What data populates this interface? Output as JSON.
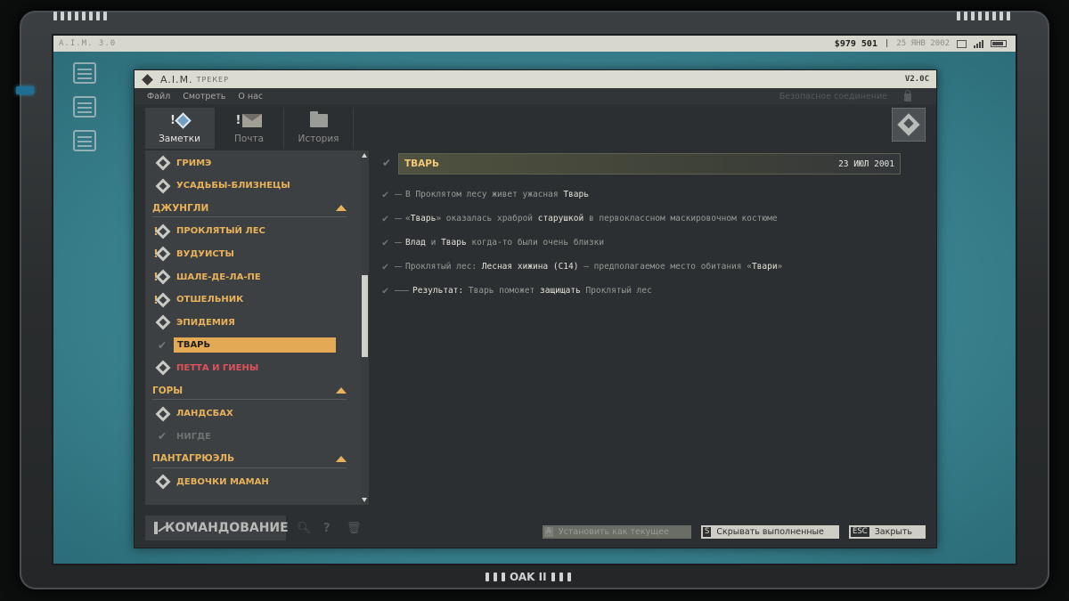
{
  "os": {
    "title": "A.I.M. 3.0",
    "money": "$979 501",
    "date": "25 ЯНВ 2002"
  },
  "brand": "OAK II",
  "window": {
    "name": "A.I.M.",
    "subtitle": "ТРЕКЕР",
    "version": "V2.0C",
    "menu": [
      "Файл",
      "Смотреть",
      "О нас"
    ],
    "secure": "Безопасное соединение"
  },
  "tabs": [
    {
      "label": "Заметки",
      "icon": "notes-diamond-icon",
      "alert": "!"
    },
    {
      "label": "Почта",
      "icon": "mail-icon",
      "alert": "!"
    },
    {
      "label": "История",
      "icon": "folder-icon",
      "alert": ""
    }
  ],
  "sidebar": {
    "items": [
      {
        "type": "item",
        "label": "ГРИМЭ",
        "alert": false,
        "state": "normal"
      },
      {
        "type": "item",
        "label": "УСАДЬБЫ-БЛИЗНЕЦЫ",
        "alert": false,
        "state": "normal"
      },
      {
        "type": "category",
        "label": "ДЖУНГЛИ"
      },
      {
        "type": "item",
        "label": "ПРОКЛЯТЫЙ ЛЕС",
        "alert": true,
        "state": "normal"
      },
      {
        "type": "item",
        "label": "ВУДУИСТЫ",
        "alert": true,
        "state": "normal"
      },
      {
        "type": "item",
        "label": "ШАЛЕ-ДЕ-ЛА-ПЕ",
        "alert": true,
        "state": "normal"
      },
      {
        "type": "item",
        "label": "ОТШЕЛЬНИК",
        "alert": true,
        "state": "normal"
      },
      {
        "type": "item",
        "label": "ЭПИДЕМИЯ",
        "alert": false,
        "state": "normal"
      },
      {
        "type": "item",
        "label": "ТВАРЬ",
        "alert": false,
        "state": "selected"
      },
      {
        "type": "item",
        "label": "ПЕТТА И ГИЕНЫ",
        "alert": false,
        "state": "red"
      },
      {
        "type": "category",
        "label": "ГОРЫ"
      },
      {
        "type": "item",
        "label": "ЛАНДСБАХ",
        "alert": false,
        "state": "normal"
      },
      {
        "type": "item",
        "label": "НИГДЕ",
        "alert": false,
        "state": "done"
      },
      {
        "type": "category",
        "label": "ПАНТАГРЮЭЛЬ"
      },
      {
        "type": "item",
        "label": "ДЕВОЧКИ МАМАН",
        "alert": false,
        "state": "normal"
      }
    ]
  },
  "detail": {
    "title": "ТВАРЬ",
    "date": "23 ИЮЛ 2001",
    "notes": [
      {
        "parts": [
          [
            "В Проклятом лесу живет ужасная ",
            false
          ],
          [
            "Тварь",
            true
          ]
        ],
        "sub": false
      },
      {
        "parts": [
          [
            "«",
            false
          ],
          [
            "Тварь",
            true
          ],
          [
            "» оказалась храброй ",
            false
          ],
          [
            "старушкой",
            true
          ],
          [
            " в первоклассном маскировочном костюме",
            false
          ]
        ],
        "sub": false
      },
      {
        "parts": [
          [
            "Влад",
            true
          ],
          [
            " и ",
            false
          ],
          [
            "Тварь",
            true
          ],
          [
            " когда-то были очень близки",
            false
          ]
        ],
        "sub": false
      },
      {
        "parts": [
          [
            "Проклятый лес: ",
            false
          ],
          [
            "Лесная хижина (C14)",
            true
          ],
          [
            " – предполагаемое место обитания «",
            false
          ],
          [
            "Твари",
            true
          ],
          [
            "»",
            false
          ]
        ],
        "sub": false
      },
      {
        "parts": [
          [
            "Результат: ",
            true
          ],
          [
            "Тварь поможет ",
            false
          ],
          [
            "защищать",
            true
          ],
          [
            " Проклятый лес",
            false
          ]
        ],
        "sub": true
      }
    ]
  },
  "footer": {
    "command": "КОМАНДОВАНИЕ",
    "buttons": [
      {
        "key": "A",
        "label": "Установить как текущее",
        "enabled": false
      },
      {
        "key": "S",
        "label": "Скрывать выполненные",
        "enabled": true
      },
      {
        "key": "ESC",
        "label": "Закрыть",
        "enabled": true
      }
    ]
  }
}
